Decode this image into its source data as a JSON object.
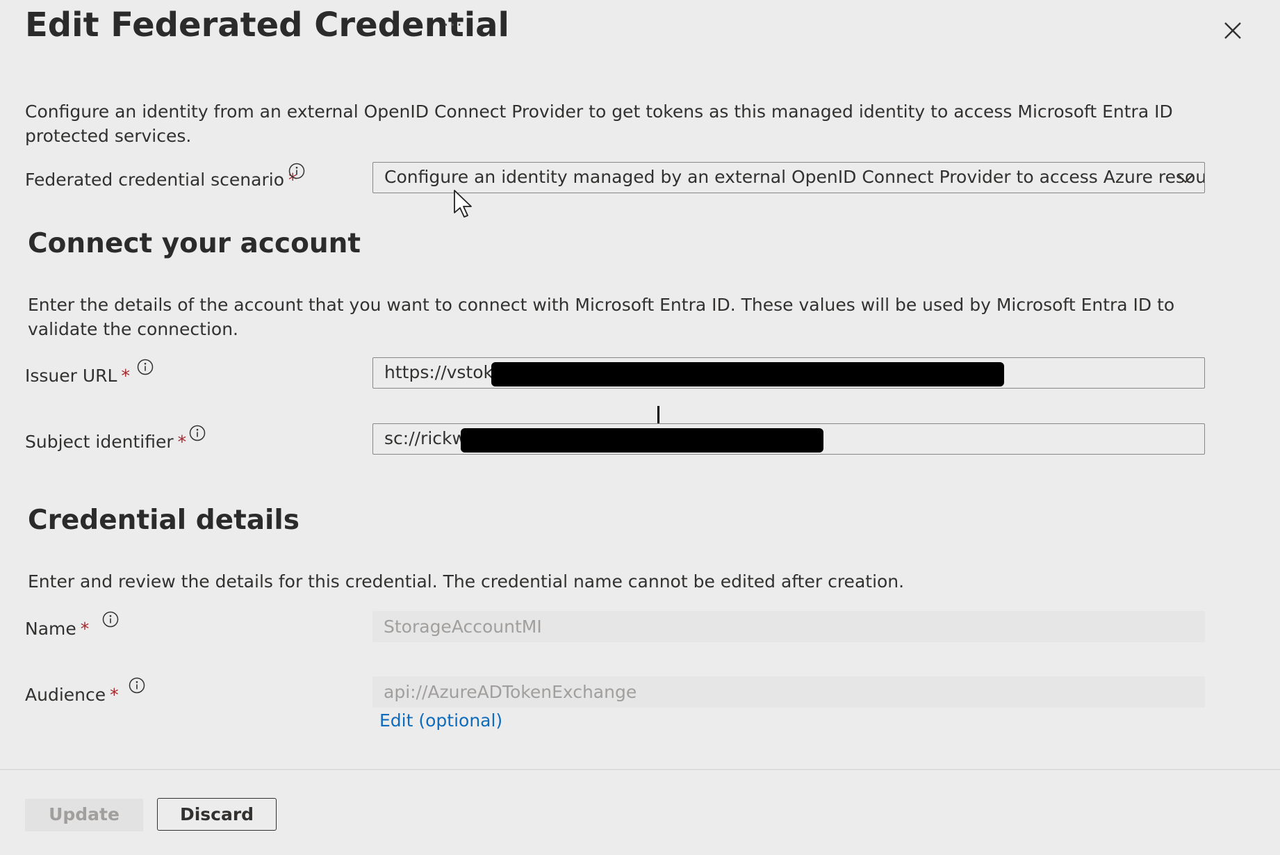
{
  "panel": {
    "title": "Edit Federated Credential",
    "more_label": "···",
    "description": "Configure an identity from an external OpenID Connect Provider to get tokens as this managed identity to access Microsoft Entra ID protected services."
  },
  "scenario": {
    "label": "Federated credential scenario",
    "required_mark": "*",
    "value": "Configure an identity managed by an external OpenID Connect Provider to access Azure resourc..."
  },
  "connect": {
    "heading": "Connect your account",
    "description": "Enter the details of the account that you want to connect with Microsoft Entra ID. These values will be used by Microsoft Entra ID to validate the connection.",
    "issuer_label": "Issuer URL",
    "issuer_value": "https://vstoke",
    "subject_label": "Subject identifier",
    "subject_value": "sc://rickw",
    "required_mark": "*"
  },
  "credential": {
    "heading": "Credential details",
    "description": "Enter and review the details for this credential. The credential name cannot be edited after creation.",
    "name_label": "Name",
    "name_value": "StorageAccountMI",
    "audience_label": "Audience",
    "audience_value": "api://AzureADTokenExchange",
    "edit_link": "Edit (optional)",
    "required_mark": "*"
  },
  "footer": {
    "update_label": "Update",
    "discard_label": "Discard"
  },
  "icons": {
    "close": "close-icon",
    "info": "info-icon",
    "chevron": "chevron-down-icon",
    "cursor": "mouse-pointer-icon"
  },
  "colors": {
    "background": "#ececec",
    "required": "#a4262c",
    "link": "#0f6cbd",
    "disabled_text": "#a19f9d"
  }
}
